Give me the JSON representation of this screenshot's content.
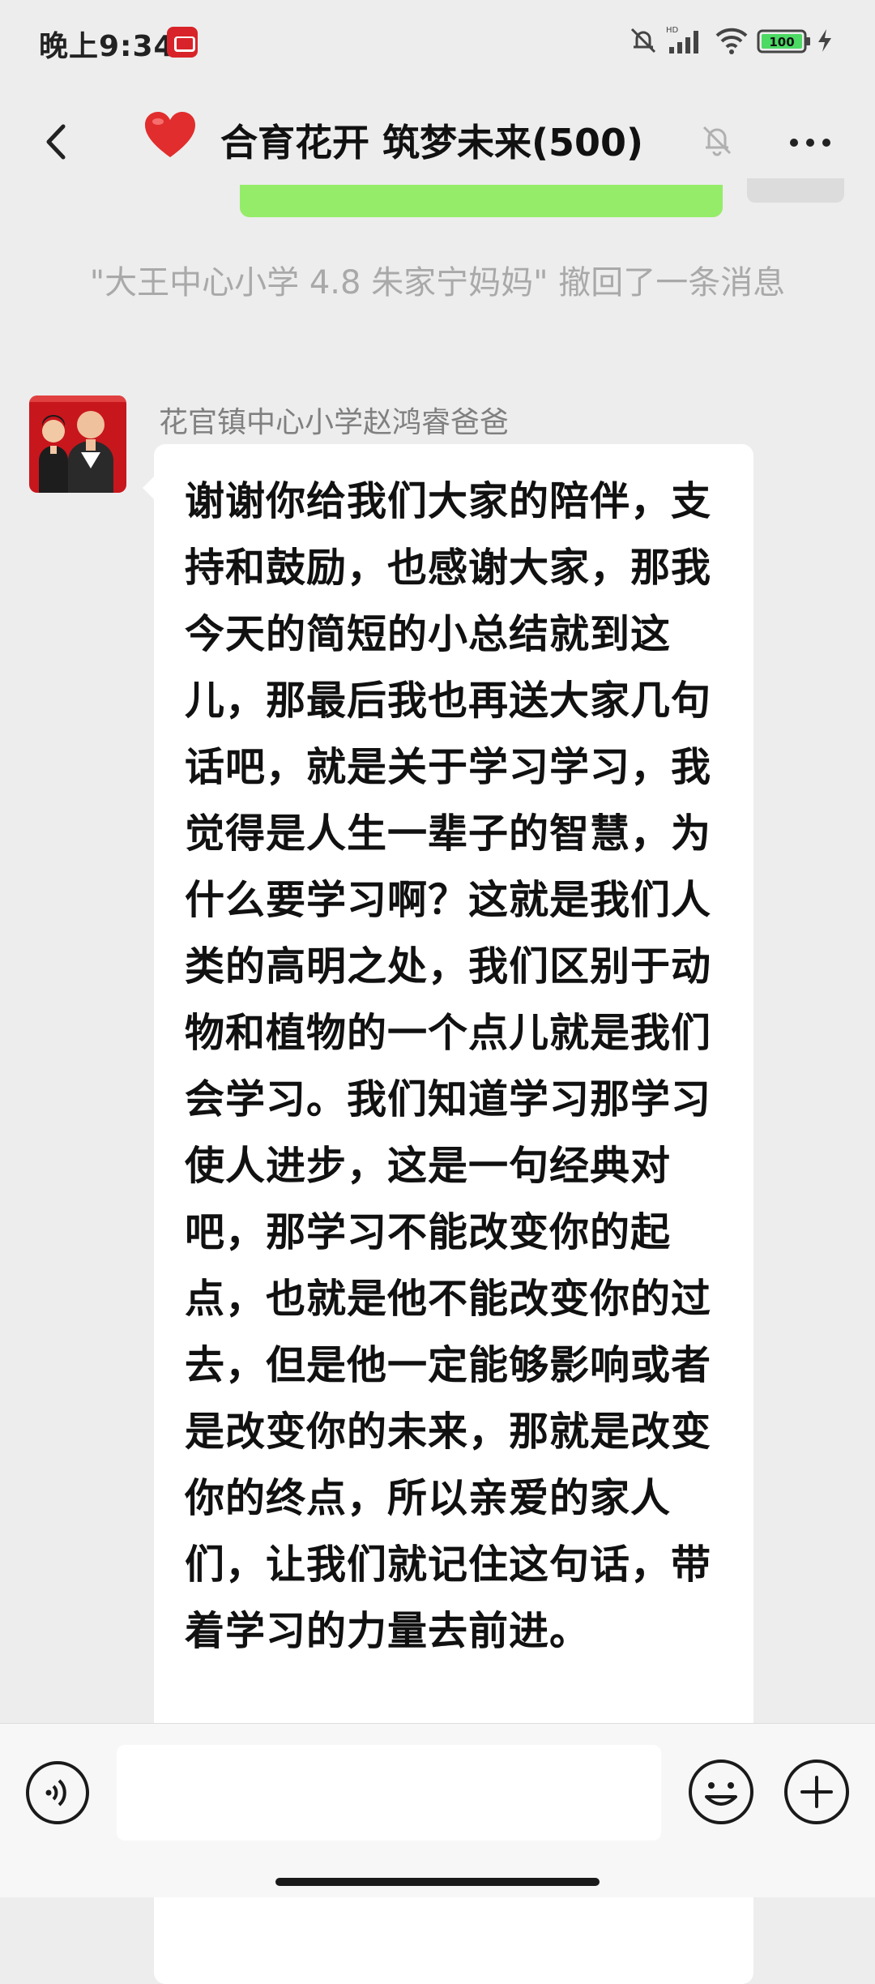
{
  "status_bar": {
    "time": "晚上9:34",
    "battery": "100",
    "network_label": "HD"
  },
  "header": {
    "title": "合育花开 筑梦未来(500)"
  },
  "chat": {
    "system_notice": "\"大王中心小学 4.8 朱家宁妈妈\" 撤回了一条消息",
    "messages": [
      {
        "sender": "花官镇中心小学赵鸿睿爸爸",
        "text": "谢谢你给我们大家的陪伴，支持和鼓励，也感谢大家，那我今天的简短的小总结就到这儿，那最后我也再送大家几句话吧，就是关于学习学习，我觉得是人生一辈子的智慧，为什么要学习啊？这就是我们人类的高明之处，我们区别于动物和植物的一个点儿就是我们会学习。我们知道学习那学习使人进步，这是一句经典对吧，那学习不能改变你的起点，也就是他不能改变你的过去，但是他一定能够影响或者是改变你的未来，那就是改变你的终点，所以亲爱的家人们，让我们就记住这句话，带着学习的力量去前进。"
      }
    ]
  },
  "input_bar": {
    "placeholder": ""
  },
  "colors": {
    "background": "#ededed",
    "own_bubble": "#95ec69",
    "other_bubble": "#ffffff",
    "battery_fill": "#4cd964"
  },
  "icons": {
    "back": "chevron-left-icon",
    "group": "heart-icon",
    "mute": "bell-off-icon",
    "more": "more-dots-icon",
    "voice": "voice-icon",
    "emoji": "emoji-icon",
    "plus": "plus-icon"
  }
}
